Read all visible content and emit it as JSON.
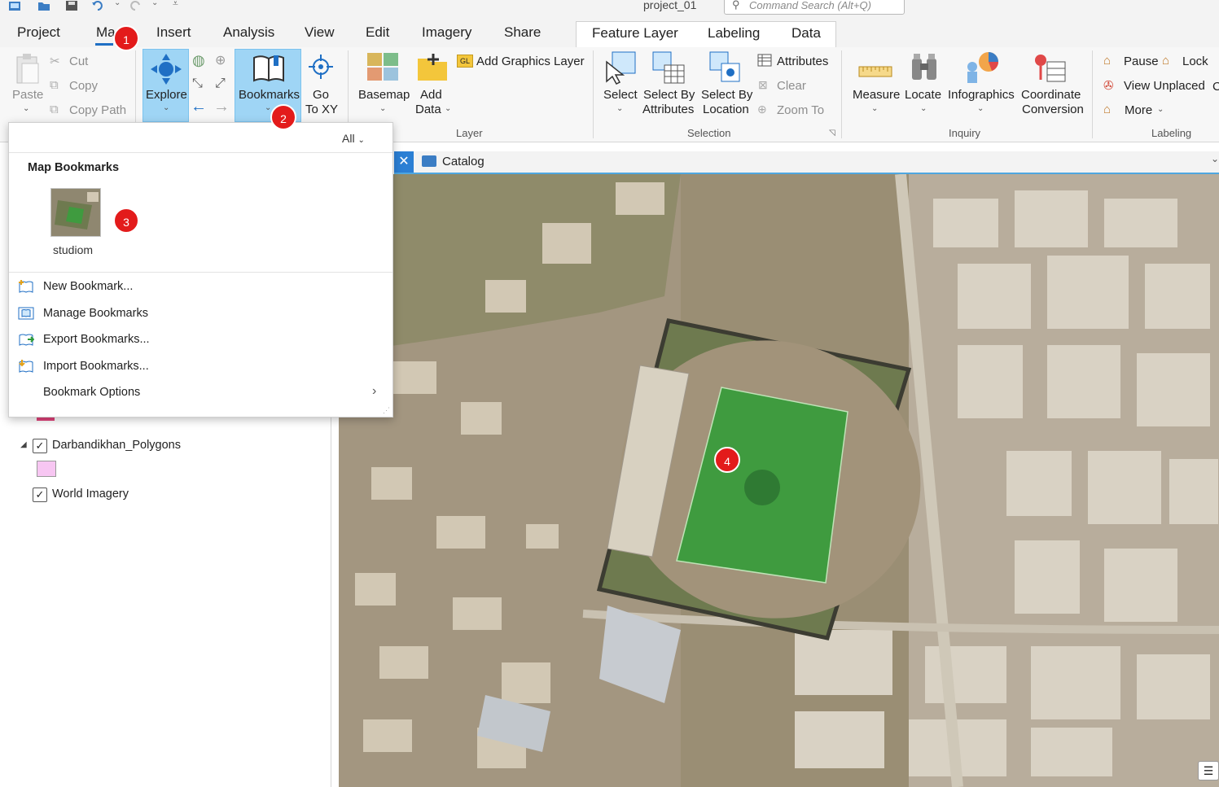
{
  "title_bar": {
    "document_title": "project_01",
    "command_search_placeholder": "Command Search (Alt+Q)"
  },
  "tabs": [
    {
      "label": "Project"
    },
    {
      "label": "Ma"
    },
    {
      "label": "Insert"
    },
    {
      "label": "Analysis"
    },
    {
      "label": "View"
    },
    {
      "label": "Edit"
    },
    {
      "label": "Imagery"
    },
    {
      "label": "Share"
    }
  ],
  "context_tabs": [
    {
      "label": "Feature Layer"
    },
    {
      "label": "Labeling"
    },
    {
      "label": "Data"
    }
  ],
  "ribbon": {
    "clipboard": {
      "paste": "Paste",
      "cut": "Cut",
      "copy": "Copy",
      "copy_path": "Copy Path"
    },
    "navigate": {
      "explore": "Explore",
      "bookmarks": "Bookmarks",
      "go_to_xy_1": "Go",
      "go_to_xy_2": "To XY"
    },
    "layer": {
      "group": "Layer",
      "basemap": "Basemap",
      "add_data_1": "Add",
      "add_data_2": "Data",
      "add_graphics_layer": "Add Graphics Layer"
    },
    "selection": {
      "group": "Selection",
      "select": "Select",
      "select_by_attr_1": "Select By",
      "select_by_attr_2": "Attributes",
      "select_by_loc_1": "Select By",
      "select_by_loc_2": "Location",
      "attributes": "Attributes",
      "clear": "Clear",
      "zoom_to": "Zoom To"
    },
    "inquiry": {
      "group": "Inquiry",
      "measure": "Measure",
      "locate": "Locate",
      "infographics": "Infographics",
      "coord_1": "Coordinate",
      "coord_2": "Conversion"
    },
    "labeling": {
      "group": "Labeling",
      "pause": "Pause",
      "lock": "Lock",
      "view_unplaced": "View Unplaced",
      "more": "More"
    }
  },
  "dropdown": {
    "filter": "All",
    "section_title": "Map Bookmarks",
    "bookmark_name": "studiom",
    "items": [
      {
        "label": "New Bookmark..."
      },
      {
        "label": "Manage Bookmarks"
      },
      {
        "label": "Export Bookmarks..."
      },
      {
        "label": "Import Bookmarks..."
      },
      {
        "label": "Bookmark Options"
      }
    ]
  },
  "contents": {
    "layer1": "Darbandikhan_Polygons",
    "layer2": "World Imagery",
    "layer1_swatch_color": "#f7c6f2"
  },
  "views": {
    "catalog_tab": "Catalog"
  },
  "markers": [
    "1",
    "2",
    "3",
    "4"
  ]
}
